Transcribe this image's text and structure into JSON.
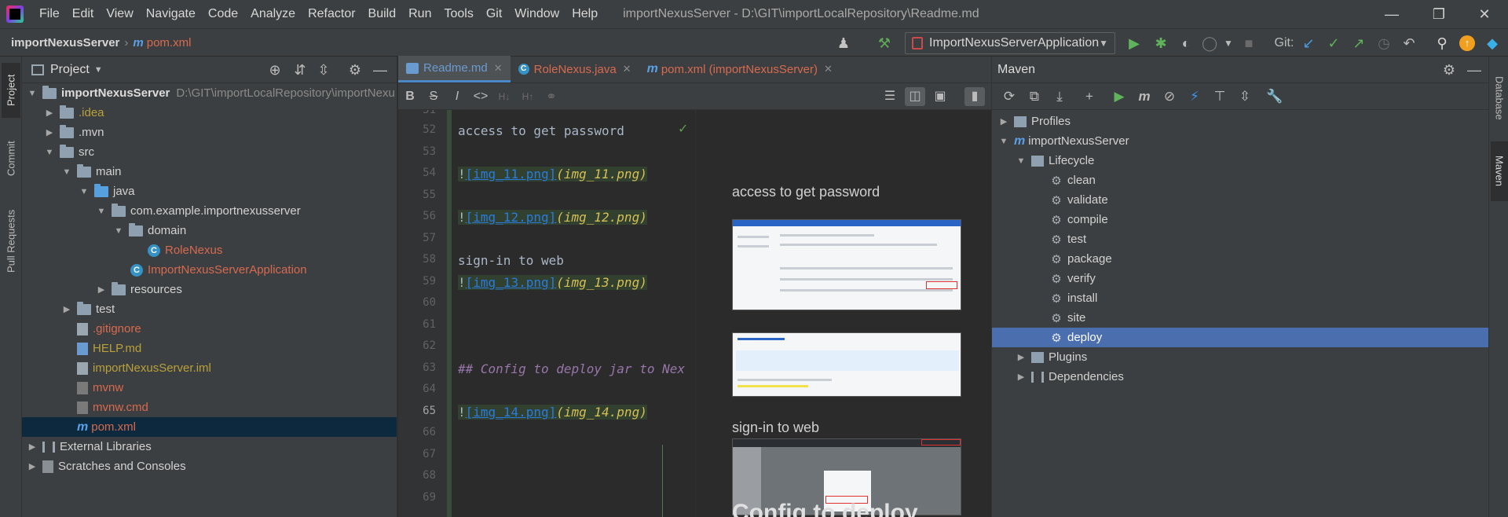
{
  "window": {
    "title": "importNexusServer - D:\\GIT\\importLocalRepository\\Readme.md"
  },
  "menu": [
    "File",
    "Edit",
    "View",
    "Navigate",
    "Code",
    "Analyze",
    "Refactor",
    "Build",
    "Run",
    "Tools",
    "Git",
    "Window",
    "Help"
  ],
  "navbar": {
    "project": "importNexusServer",
    "file": "pom.xml",
    "run_config": "ImportNexusServerApplication",
    "git_label": "Git:"
  },
  "left_strip": {
    "tabs": [
      "Project",
      "Commit",
      "Pull Requests"
    ]
  },
  "project_panel": {
    "title": "Project",
    "tree": [
      {
        "label": "importNexusServer",
        "path": "D:\\GIT\\importLocalRepository\\importNexu"
      },
      {
        "label": ".idea"
      },
      {
        "label": ".mvn"
      },
      {
        "label": "src"
      },
      {
        "label": "main"
      },
      {
        "label": "java"
      },
      {
        "label": "com.example.importnexusserver"
      },
      {
        "label": "domain"
      },
      {
        "label": "RoleNexus"
      },
      {
        "label": "ImportNexusServerApplication"
      },
      {
        "label": "resources"
      },
      {
        "label": "test"
      },
      {
        "label": ".gitignore"
      },
      {
        "label": "HELP.md"
      },
      {
        "label": "importNexusServer.iml"
      },
      {
        "label": "mvnw"
      },
      {
        "label": "mvnw.cmd"
      },
      {
        "label": "pom.xml"
      },
      {
        "label": "External Libraries"
      },
      {
        "label": "Scratches and Consoles"
      }
    ]
  },
  "editor": {
    "tabs": [
      {
        "label": "Readme.md"
      },
      {
        "label": "RoleNexus.java"
      },
      {
        "label": "pom.xml (importNexusServer)"
      }
    ],
    "line_numbers": [
      "51",
      "52",
      "53",
      "54",
      "55",
      "56",
      "57",
      "58",
      "59",
      "60",
      "61",
      "62",
      "63",
      "64",
      "65",
      "66",
      "67",
      "68",
      "69"
    ],
    "code": {
      "l52": "access to get password",
      "l54_link": "[img_11.png]",
      "l54_img": "(img_11.png)",
      "l56_link": "[img_12.png]",
      "l56_img": "(img_12.png)",
      "l58": "sign-in to web",
      "l59_link": "[img_13.png]",
      "l59_img": "(img_13.png)",
      "l63": "## Config to deploy jar to Nex",
      "l65_link": "[img_14.png]",
      "l65_img": "(img_14.png)",
      "bang": "!"
    },
    "preview": {
      "h1": "access to get password",
      "h2": "sign-in to web",
      "h3": "Config to deploy"
    }
  },
  "maven_panel": {
    "title": "Maven",
    "tree": [
      {
        "label": "Profiles"
      },
      {
        "label": "importNexusServer"
      },
      {
        "label": "Lifecycle"
      },
      {
        "label": "clean"
      },
      {
        "label": "validate"
      },
      {
        "label": "compile"
      },
      {
        "label": "test"
      },
      {
        "label": "package"
      },
      {
        "label": "verify"
      },
      {
        "label": "install"
      },
      {
        "label": "site"
      },
      {
        "label": "deploy"
      },
      {
        "label": "Plugins"
      },
      {
        "label": "Dependencies"
      }
    ]
  },
  "right_strip": {
    "tabs": [
      "Database",
      "Maven"
    ]
  },
  "colors": {
    "selection_blue": "#4b6eaf",
    "accent_tab": "#4a88c7",
    "git_orange": "#d66a4f",
    "ignored_yellow": "#b8a13a"
  }
}
